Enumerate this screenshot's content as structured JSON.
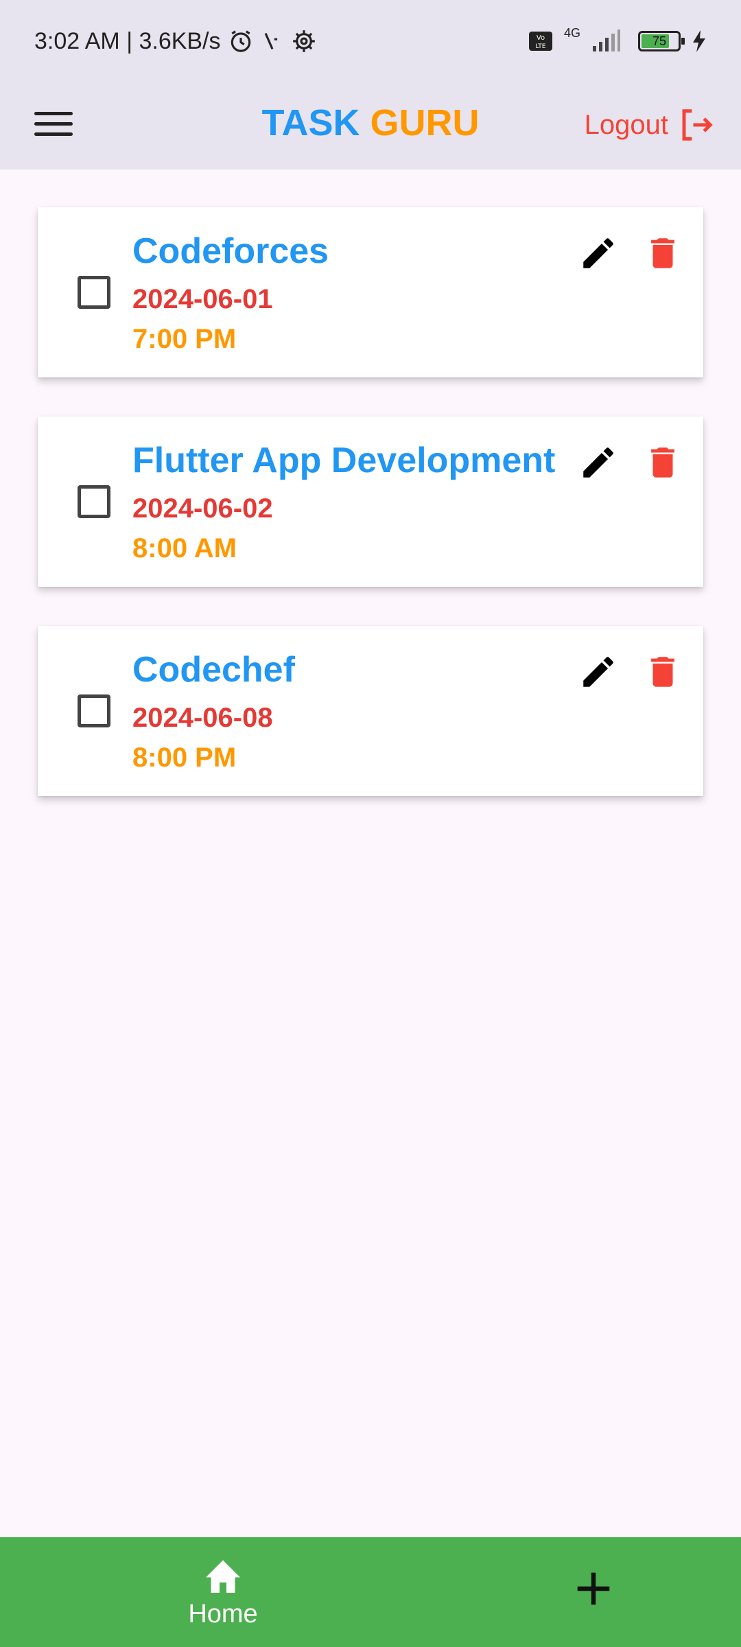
{
  "status_bar": {
    "time_speed": "3:02 AM | 3.6KB/s",
    "network": "4G",
    "volte": "Vo LTE",
    "battery": "75"
  },
  "app_bar": {
    "title_part1": "TASK",
    "title_part2": "GURU",
    "logout_label": "Logout",
    "icons": [
      "menu-icon",
      "logout-icon"
    ]
  },
  "tasks": [
    {
      "title": "Codeforces",
      "date": "2024-06-01",
      "time": "7:00 PM",
      "checked": false
    },
    {
      "title": "Flutter App Development",
      "date": "2024-06-02",
      "time": "8:00 AM",
      "checked": false
    },
    {
      "title": "Codechef",
      "date": "2024-06-08",
      "time": "8:00 PM",
      "checked": false
    }
  ],
  "bottom_nav": {
    "home_label": "Home",
    "icons": [
      "home-icon",
      "add-icon"
    ]
  },
  "colors": {
    "title_blue": "#2196f3",
    "title_orange": "#ff9800",
    "date_red": "#e53935",
    "delete_red": "#f44336",
    "nav_green": "#4caf50",
    "bar_bg": "#e8e4ef"
  }
}
